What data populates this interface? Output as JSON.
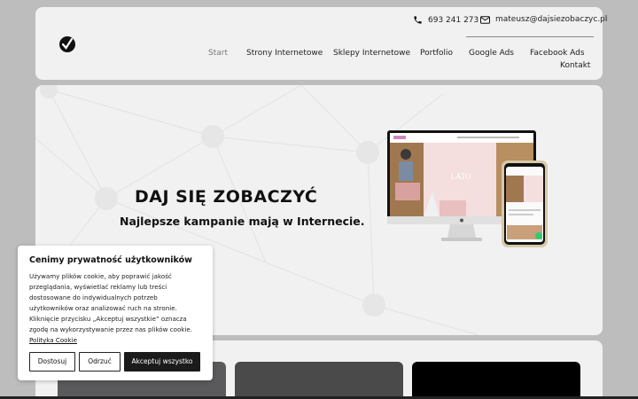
{
  "header": {
    "phone": "693 241 273",
    "email": "mateusz@dajsiezobaczyc.pl",
    "nav": [
      {
        "label": "Start",
        "active": true
      },
      {
        "label": "Strony Internetowe",
        "active": false
      },
      {
        "label": "Sklepy Internetowe",
        "active": false
      },
      {
        "label": "Portfolio",
        "active": false
      },
      {
        "label": "Google Ads",
        "active": false
      },
      {
        "label": "Facebook Ads",
        "active": false
      },
      {
        "label": "Kontakt",
        "active": false
      }
    ]
  },
  "hero": {
    "title": "DAJ SIĘ ZOBACZYĆ",
    "subtitle": "Najlepsze kampanie mają w Internecie.",
    "mockup_text": "LATO"
  },
  "cookie": {
    "title": "Cenimy prywatność użytkowników",
    "text": "Używamy plików cookie, aby poprawić jakość przeglądania, wyświetlać reklamy lub treści dostosowane do indywidualnych potrzeb użytkowników oraz analizować ruch na stronie. Kliknięcie przycisku „Akceptuj wszystkie” oznacza zgodę na wykorzystywanie przez nas plików cookie.",
    "policy_link": "Polityka Cookie",
    "btn_customize": "Dostosuj",
    "btn_reject": "Odrzuć",
    "btn_accept": "Akceptuj wszystko"
  },
  "colors": {
    "page_bg": "#bdbdbd",
    "card_bg": "#f1f1f1",
    "accent_dark": "#1b1b1b",
    "thumbs": [
      "#5a5a5c",
      "#4a4a4a",
      "#000000"
    ]
  }
}
